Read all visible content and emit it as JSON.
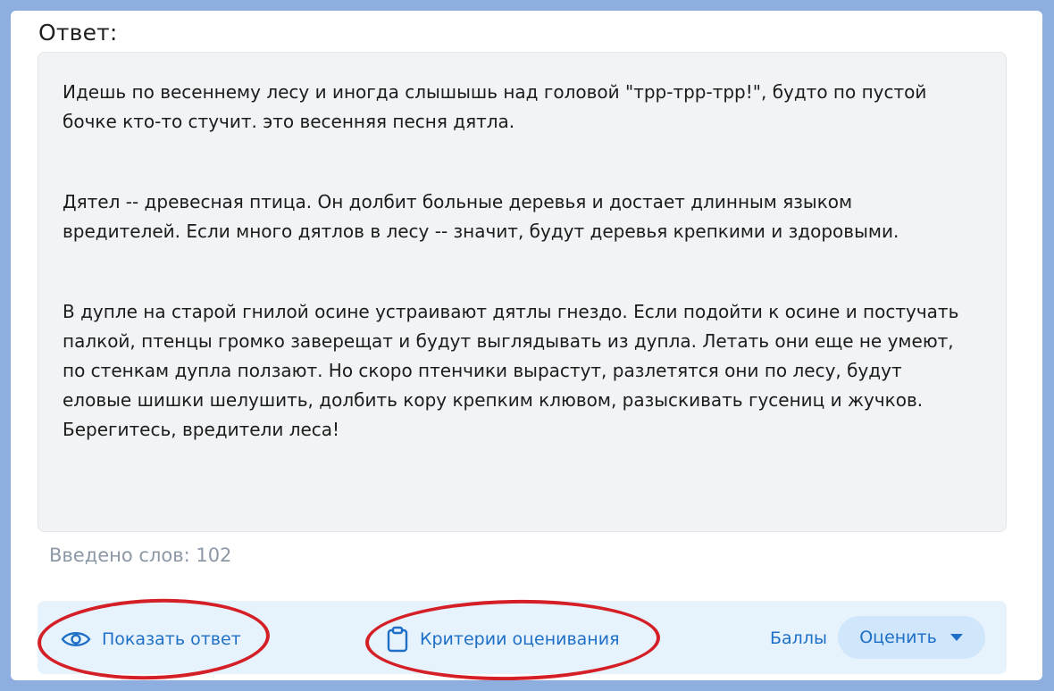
{
  "answer": {
    "label": "Ответ:",
    "paragraphs": [
      "Идешь по весеннему лесу и иногда слышышь над головой \"трр-трр-трр!\", будто по пустой\nбочке кто-то стучит. это весенняя песня дятла.",
      "Дятел -- древесная птица. Он долбит больные деревья и достает длинным языком\nвредителей. Если много дятлов в лесу -- значит, будут деревья крепкими и здоровыми.",
      "В дупле на старой гнилой осине устраивают дятлы гнездо. Если подойти к осине и постучать\nпалкой, птенцы громко заверещат и будут выглядывать из дупла. Летать они еще не умеют,\nпо стенкам дупла ползают. Но скоро птенчики вырастут, разлетятся они по лесу, будут\nеловые шишки шелушить, долбить кору крепким клювом, разыскивать гусениц и жучков.\nБерегитесь, вредители леса!"
    ],
    "word_count": "Введено слов: 102"
  },
  "toolbar": {
    "show_answer": {
      "label": "Показать ответ",
      "icon": "eye-icon"
    },
    "criteria": {
      "label": "Критерии оценивания",
      "icon": "clipboard-icon"
    },
    "score_label": "Баллы",
    "rate_button": {
      "label": "Оценить",
      "icon": "caret-down-icon"
    }
  },
  "colors": {
    "accent": "#1f6fc6",
    "toolbar_bg": "#e6f3fd",
    "answer_bg": "#f1f3f5",
    "highlight": "#d51f27",
    "frame": "#8eaee0"
  }
}
